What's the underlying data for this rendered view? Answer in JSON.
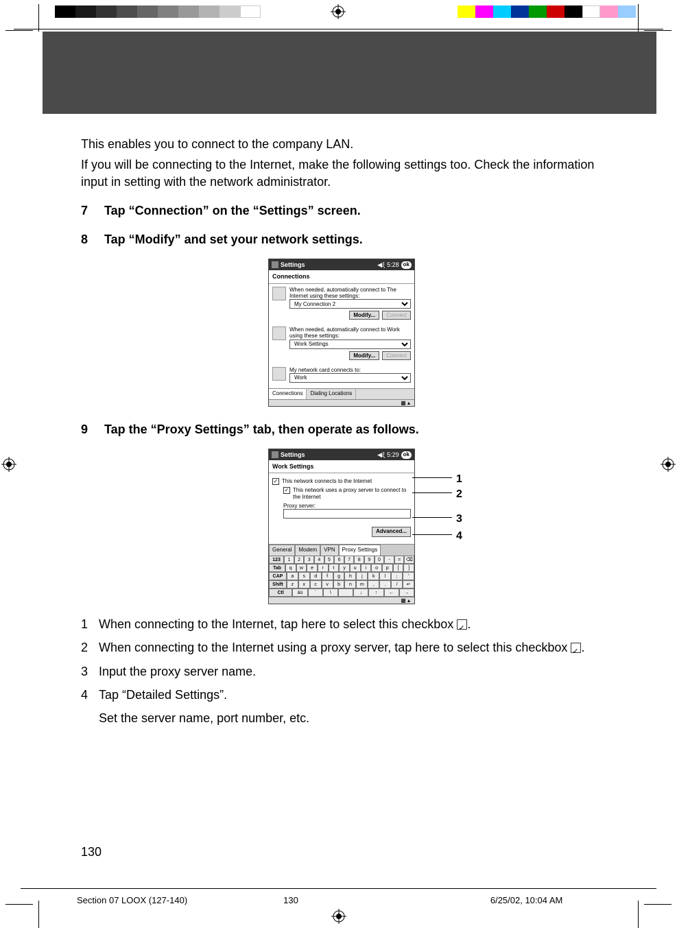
{
  "intro": {
    "p1": "This enables you to connect to the company LAN.",
    "p2": "If you will be connecting to the Internet, make the following settings too. Check the information input in setting with the network administrator."
  },
  "steps": {
    "s7": {
      "num": "7",
      "text": "Tap “Connection” on the “Settings” screen."
    },
    "s8": {
      "num": "8",
      "text": "Tap “Modify” and set your network settings."
    },
    "s9": {
      "num": "9",
      "text": "Tap the “Proxy Settings” tab, then operate as follows."
    }
  },
  "pda1": {
    "title": "Settings",
    "time": "5:28",
    "ok": "ok",
    "subtitle": "Connections",
    "block1": {
      "text": "When needed, automatically connect to The Internet using these settings:",
      "select": "My Connection 2",
      "modify": "Modify...",
      "connect": "Connect"
    },
    "block2": {
      "text": "When needed, automatically connect to Work using these settings:",
      "select": "Work Settings",
      "modify": "Modify...",
      "connect": "Connect"
    },
    "block3": {
      "text": "My network card connects to:",
      "select": "Work"
    },
    "tabs": {
      "t1": "Connections",
      "t2": "Dialing Locations"
    }
  },
  "pda2": {
    "title": "Settings",
    "time": "5:29",
    "ok": "ok",
    "subtitle": "Work Settings",
    "chk1": "This network connects to the Internet",
    "chk2": "This network uses a proxy server to connect to the Internet",
    "proxyLabel": "Proxy server:",
    "advanced": "Advanced...",
    "tabs": {
      "t1": "General",
      "t2": "Modem",
      "t3": "VPN",
      "t4": "Proxy Settings"
    },
    "kb": {
      "r1": [
        "123",
        "1",
        "2",
        "3",
        "4",
        "5",
        "6",
        "7",
        "8",
        "9",
        "0",
        "-",
        "=",
        "⌫"
      ],
      "r2": [
        "Tab",
        "q",
        "w",
        "e",
        "r",
        "t",
        "y",
        "u",
        "i",
        "o",
        "p",
        "[",
        "]"
      ],
      "r3": [
        "CAP",
        "a",
        "s",
        "d",
        "f",
        "g",
        "h",
        "j",
        "k",
        "l",
        ";",
        "'"
      ],
      "r4": [
        "Shift",
        "z",
        "x",
        "c",
        "v",
        "b",
        "n",
        "m",
        ",",
        ".",
        "/",
        "↵"
      ],
      "r5": [
        "Ctl",
        "áü",
        "`",
        "\\",
        " ",
        "↓",
        "↑",
        "←",
        "→"
      ]
    }
  },
  "callouts": {
    "c1": "1",
    "c2": "2",
    "c3": "3",
    "c4": "4"
  },
  "sublist": {
    "i1": {
      "n": "1",
      "t_a": "When connecting to the Internet, tap here to select this checkbox ",
      "t_b": "."
    },
    "i2": {
      "n": "2",
      "t_a": "When connecting to the Internet using a proxy server, tap here to select this checkbox ",
      "t_b": "."
    },
    "i3": {
      "n": "3",
      "t": "Input the proxy server name."
    },
    "i4": {
      "n": "4",
      "t": "Tap “Detailed Settings”.",
      "sub": "Set the server name, port number, etc."
    }
  },
  "pageNumber": "130",
  "footer": {
    "section": "Section 07 LOOX (127-140)",
    "page": "130",
    "datetime": "6/25/02, 10:04 AM"
  }
}
